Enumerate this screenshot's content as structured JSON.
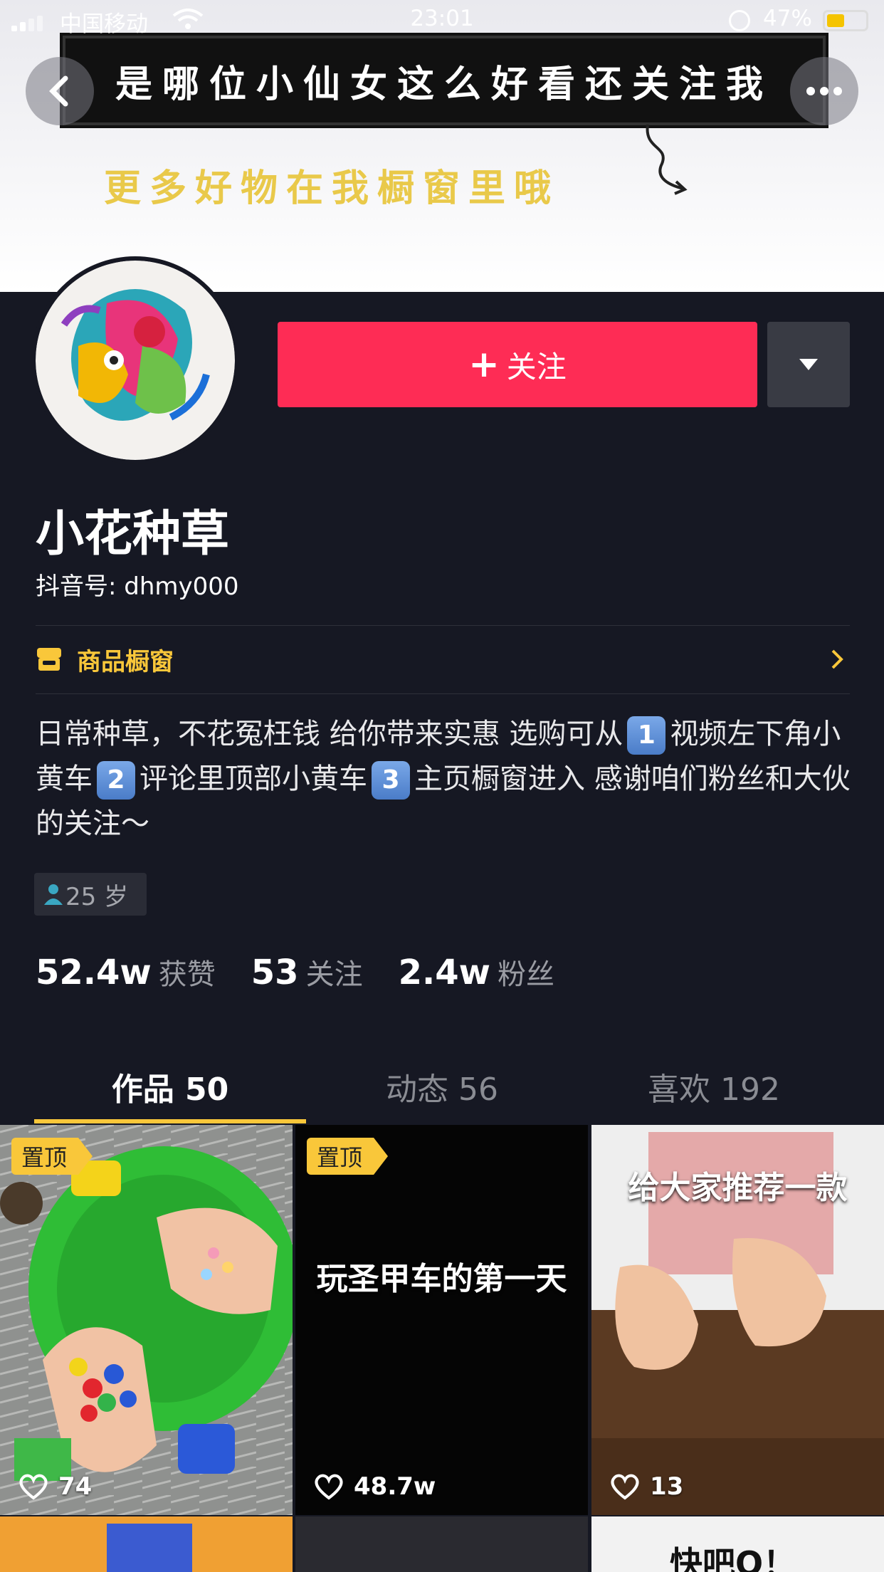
{
  "status_bar": {
    "carrier": "中国移动",
    "time": "23:01",
    "battery": "47%"
  },
  "banner": {
    "headline": "是哪位小仙女这么好看还关注我",
    "subline": "更多好物在我橱窗里哦"
  },
  "profile": {
    "follow_label": "关注",
    "name": "小花种草",
    "douyin_id": "抖音号: dhmy000",
    "shop_label": "商品橱窗",
    "bio_parts": [
      "日常种草，不花冤枉钱 给你带来实惠 选购可从",
      "1",
      "视频左下角小黄车",
      "2",
      "评论里顶部小黄车",
      "3",
      "主页橱窗进入 感谢咱们粉丝和大伙的关注～"
    ],
    "age": "25 岁"
  },
  "stats": [
    {
      "num": "52.4w",
      "label": "获赞"
    },
    {
      "num": "53",
      "label": "关注"
    },
    {
      "num": "2.4w",
      "label": "粉丝"
    }
  ],
  "tabs": [
    {
      "label": "作品 50"
    },
    {
      "label": "动态 56"
    },
    {
      "label": "喜欢 192"
    }
  ],
  "videos": [
    {
      "pinned": "置顶",
      "caption": "",
      "likes": "74"
    },
    {
      "pinned": "置顶",
      "caption": "玩圣甲车的第一天",
      "likes": "48.7w"
    },
    {
      "pinned": "",
      "caption": "给大家推荐一款",
      "likes": "13"
    }
  ],
  "row2_caption": "快吧Q！",
  "colors": {
    "accent": "#fe2c55",
    "gold": "#f9c73a",
    "bg": "#161823"
  }
}
